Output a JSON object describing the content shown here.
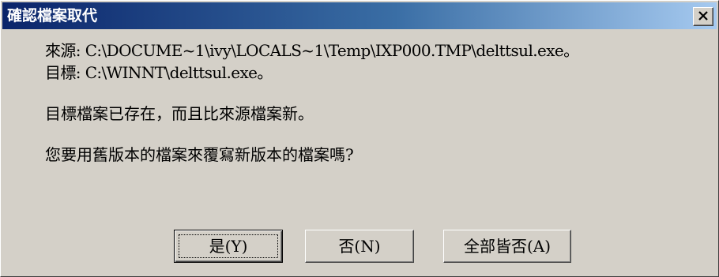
{
  "window": {
    "title": "確認檔案取代"
  },
  "message": {
    "source_line": "來源: C:\\DOCUME~1\\ivy\\LOCALS~1\\Temp\\IXP000.TMP\\delttsul.exe。",
    "target_line": "目標: C:\\WINNT\\delttsul.exe。",
    "status_line": "目標檔案已存在，而且比來源檔案新。",
    "question_line": "您要用舊版本的檔案來覆寫新版本的檔案嗎?"
  },
  "buttons": {
    "yes_label": "是(Y)",
    "no_label": "否(N)",
    "no_to_all_label": "全部皆否(A)"
  },
  "colors": {
    "titlebar_start": "#0a246a",
    "titlebar_end": "#a6caf0",
    "dialog_face": "#d4d0c8"
  },
  "icons": {
    "close": "close-icon"
  }
}
